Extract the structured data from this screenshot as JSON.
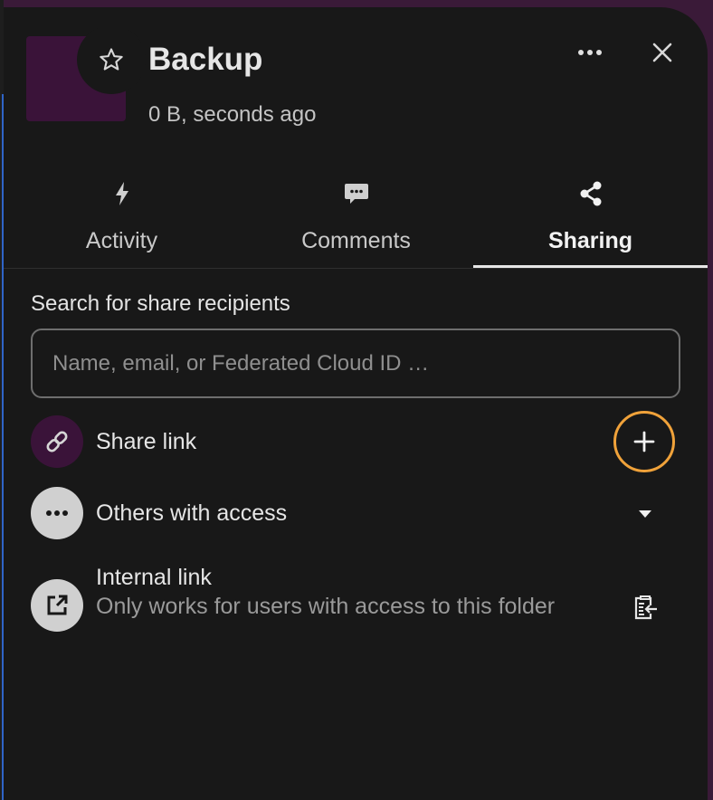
{
  "file": {
    "title": "Backup",
    "subtitle": "0 B, seconds ago"
  },
  "header": {
    "favorite_icon": "star-outline-icon",
    "menu_icon": "more-horizontal-icon",
    "close_icon": "close-icon"
  },
  "tabs": [
    {
      "label": "Activity",
      "icon": "lightning-icon",
      "active": false
    },
    {
      "label": "Comments",
      "icon": "comment-icon",
      "active": false
    },
    {
      "label": "Sharing",
      "icon": "share-icon",
      "active": true
    }
  ],
  "sharing": {
    "search_label": "Search for share recipients",
    "search_value": "",
    "search_placeholder": "Name, email, or Federated Cloud ID …",
    "share_link": {
      "label": "Share link",
      "icon": "link-icon",
      "avatar_color": "#3a1339",
      "action_icon": "plus-icon",
      "action_ring_color": "#f0a23a"
    },
    "others_with_access": {
      "label": "Others with access",
      "icon": "dots-icon",
      "avatar_color": "#d0d0d0",
      "action_icon": "caret-down-icon"
    },
    "internal_link": {
      "label": "Internal link",
      "description": "Only works for users with access to this folder",
      "icon": "open-in-new-icon",
      "avatar_color": "#d0d0d0",
      "action_icon": "clipboard-copy-icon"
    }
  },
  "colors": {
    "panel_background": "#181818",
    "app_background": "#3a1a38",
    "thumbnail": "#3a1339",
    "accent_focus": "#f0a23a"
  }
}
